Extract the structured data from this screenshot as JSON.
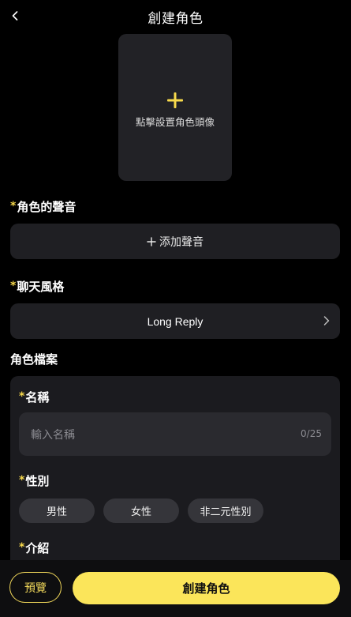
{
  "header": {
    "title": "創建角色",
    "back_icon": "chevron-left-icon"
  },
  "avatar": {
    "label": "點擊設置角色頭像",
    "icon": "plus-icon",
    "accent": "#f7d94c"
  },
  "voice": {
    "required_mark": "*",
    "label": "角色的聲音",
    "add_label": "添加聲音"
  },
  "chat_style": {
    "required_mark": "*",
    "label": "聊天風格",
    "value": "Long Reply"
  },
  "profile": {
    "section_title": "角色檔案",
    "name": {
      "required_mark": "*",
      "label": "名稱",
      "placeholder": "輸入名稱",
      "counter": "0/25"
    },
    "gender": {
      "required_mark": "*",
      "label": "性別",
      "options": [
        "男性",
        "女性",
        "非二元性別"
      ]
    },
    "intro": {
      "required_mark": "*",
      "label": "介紹"
    }
  },
  "footer": {
    "preview_label": "預覽",
    "create_label": "創建角色",
    "accent": "#fbe55a"
  }
}
